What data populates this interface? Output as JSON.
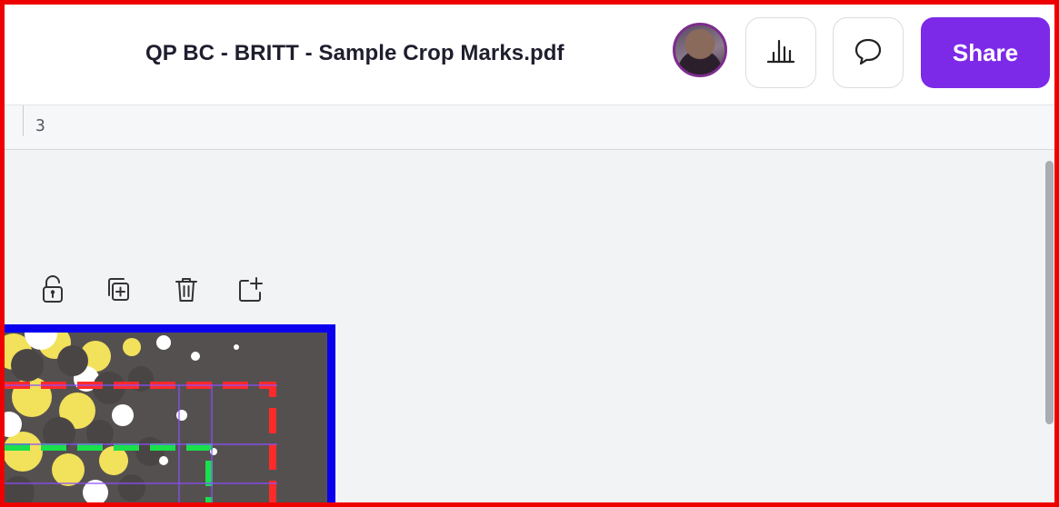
{
  "header": {
    "document_title": "QP BC - BRITT - Sample Crop Marks.pdf",
    "avatar_icon": "user-avatar",
    "insights_icon": "bar-chart-icon",
    "comment_icon": "comment-icon",
    "share_label": "Share"
  },
  "ruler": {
    "label": "3"
  },
  "page_toolbar": {
    "icons": [
      "unlock-icon",
      "duplicate-page-icon",
      "trash-icon",
      "add-page-icon"
    ]
  },
  "colors": {
    "share_button": "#7d2ae8",
    "frame_border": "#ee0000",
    "bleed_border": "#0a00ee",
    "crop_mark_red": "#ff2a2a",
    "safe_zone_green": "#19e04b",
    "guide_purple": "#8a4dff",
    "page_background": "#555050",
    "dot_yellow": "#f2e15a"
  }
}
